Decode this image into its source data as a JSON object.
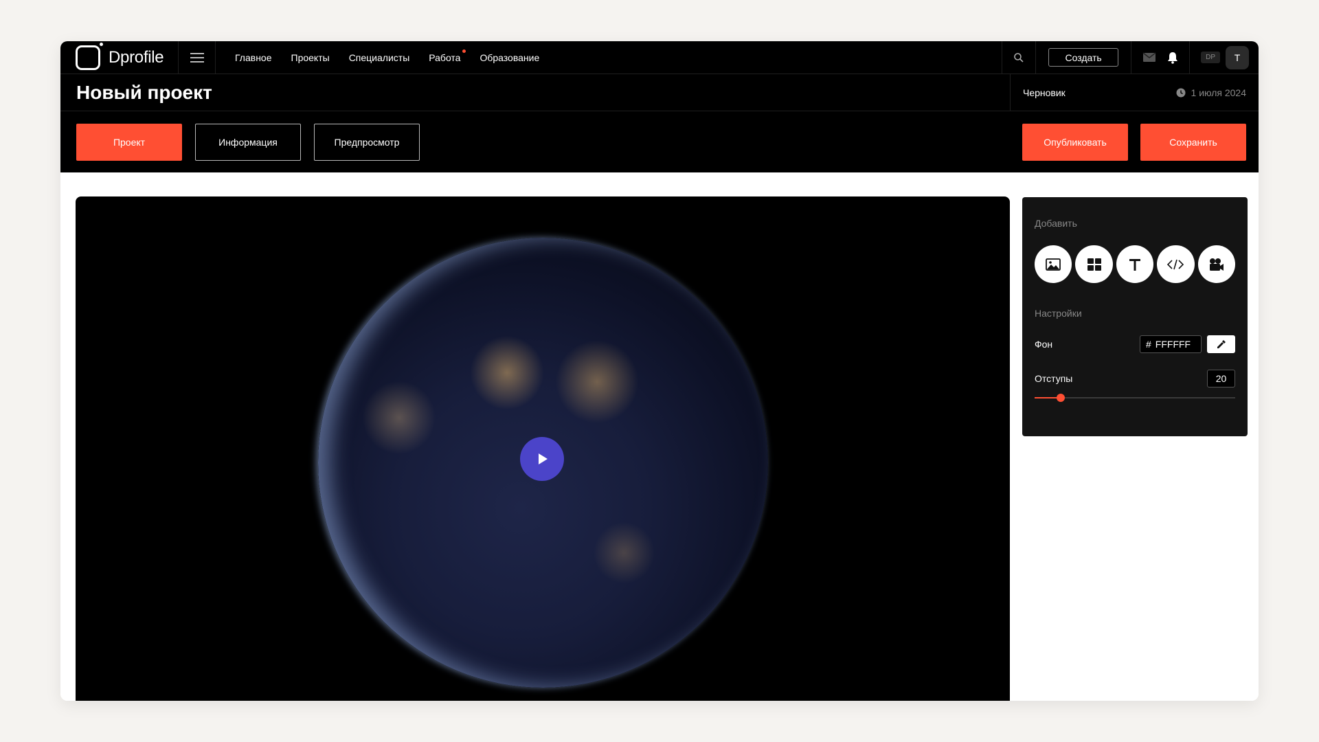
{
  "brand": {
    "name": "Dprofile"
  },
  "nav": {
    "items": [
      {
        "label": "Главное"
      },
      {
        "label": "Проекты"
      },
      {
        "label": "Специалисты"
      },
      {
        "label": "Работа",
        "has_dot": true
      },
      {
        "label": "Образование"
      }
    ]
  },
  "topbar": {
    "create_label": "Создать",
    "badge": "DP",
    "avatar_initial": "T"
  },
  "page": {
    "title": "Новый проект",
    "status": "Черновик",
    "date": "1 июля 2024"
  },
  "actions": {
    "tab_project": "Проект",
    "tab_info": "Информация",
    "tab_preview": "Предпросмотр",
    "publish": "Опубликовать",
    "save": "Сохранить"
  },
  "panel": {
    "add_label": "Добавить",
    "add_buttons": [
      "image-icon",
      "grid-icon",
      "text-icon",
      "code-icon",
      "video-icon"
    ],
    "settings_label": "Настройки",
    "background_label": "Фон",
    "background_hash": "#",
    "background_value": "FFFFFF",
    "padding_label": "Отступы",
    "padding_value": "20",
    "padding_slider_fraction": 0.13
  },
  "colors": {
    "accent": "#ff4f33",
    "play": "#4b44c9",
    "header_bg": "#000000"
  }
}
